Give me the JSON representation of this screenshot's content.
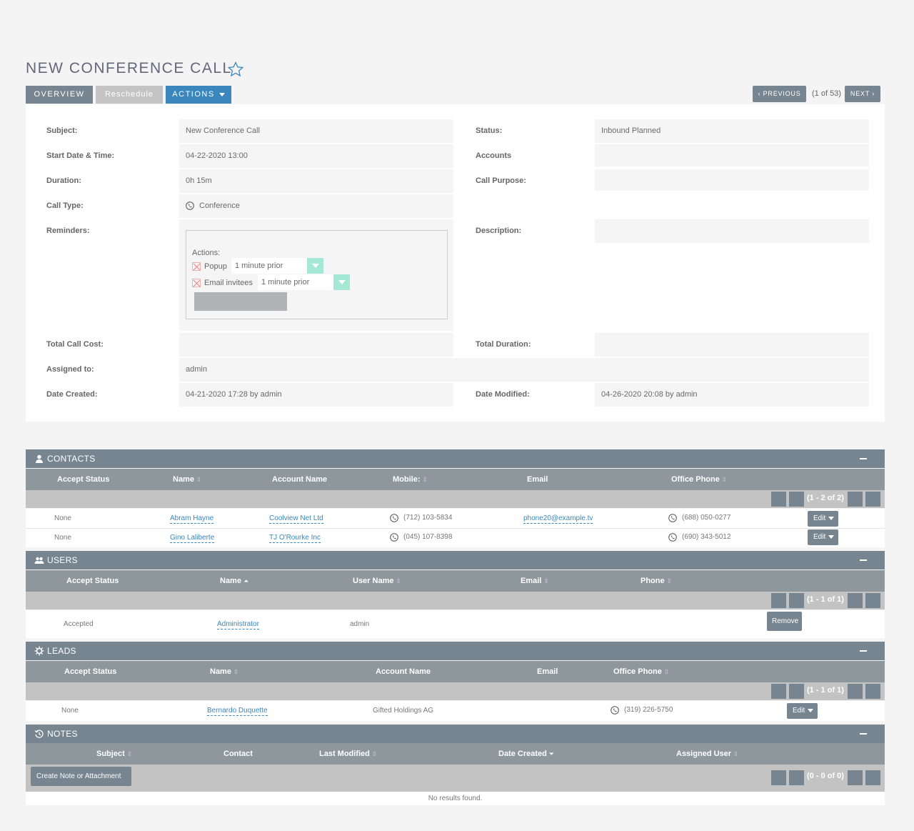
{
  "header": {
    "title": "NEW CONFERENCE CALL",
    "tabs": {
      "overview": "OVERVIEW",
      "reschedule": "Reschedule",
      "actions": "ACTIONS"
    },
    "nav": {
      "previous": "PREVIOUS",
      "count": "(1 of 53)",
      "next": "NEXT"
    }
  },
  "detail": {
    "subject_label": "Subject:",
    "subject": "New Conference Call",
    "start_label": "Start Date & Time:",
    "start": "04-22-2020 13:00",
    "duration_label": "Duration:",
    "duration": "0h 15m",
    "call_type_label": "Call Type:",
    "call_type": "Conference",
    "reminders_label": "Reminders:",
    "reminders": {
      "actions_label": "Actions:",
      "popup_label": "Popup",
      "popup_value": "1 minute prior",
      "email_label": "Email invitees",
      "email_value": "1 minute prior"
    },
    "total_cost_label": "Total Call Cost:",
    "total_cost": "",
    "assigned_label": "Assigned to:",
    "assigned": "admin",
    "created_label": "Date Created:",
    "created": "04-21-2020 17:28 by admin",
    "status_label": "Status:",
    "status": "Inbound Planned",
    "accounts_label": "Accounts",
    "accounts": "",
    "purpose_label": "Call Purpose:",
    "purpose": "",
    "description_label": "Description:",
    "description": "",
    "total_duration_label": "Total Duration:",
    "total_duration": "",
    "modified_label": "Date Modified:",
    "modified": "04-26-2020 20:08 by admin"
  },
  "contacts": {
    "title": "CONTACTS",
    "columns": [
      "Accept Status",
      "Name",
      "Account Name",
      "Mobile:",
      "Email",
      "Office Phone"
    ],
    "pager": "(1 - 2 of 2)",
    "rows": [
      {
        "status": "None",
        "name": "Abram Hayne",
        "account": "Coolview Net Ltd",
        "mobile": "(712) 103-5834",
        "email": "phone20@example.tv",
        "office": "(688) 050-0277",
        "action": "Edit"
      },
      {
        "status": "None",
        "name": "Gino Laliberte",
        "account": "TJ O'Rourke Inc",
        "mobile": "(045) 107-8398",
        "email": "",
        "office": "(690) 343-5012",
        "action": "Edit"
      }
    ]
  },
  "users": {
    "title": "USERS",
    "columns": [
      "Accept Status",
      "Name",
      "User Name",
      "Email",
      "Phone"
    ],
    "pager": "(1 - 1 of 1)",
    "rows": [
      {
        "status": "Accepted",
        "name": "Administrator",
        "username": "admin",
        "action": "Remove"
      }
    ]
  },
  "leads": {
    "title": "LEADS",
    "columns": [
      "Accept Status",
      "Name",
      "Account Name",
      "Email",
      "Office Phone"
    ],
    "pager": "(1 - 1 of 1)",
    "rows": [
      {
        "status": "None",
        "name": "Bernardo Duquette",
        "account": "Gifted Holdings AG",
        "office": "(319) 226-5750",
        "action": "Edit"
      }
    ]
  },
  "notes": {
    "title": "NOTES",
    "columns": [
      "Subject",
      "Contact",
      "Last Modified",
      "Date Created",
      "Assigned User"
    ],
    "create_button": "Create Note or Attachment",
    "pager": "(0 - 0 of 0)",
    "empty": "No results found."
  },
  "colors": {
    "accent": "#3a86bd",
    "panel_header": "#778591",
    "tab_disabled": "#c4c4c4"
  }
}
